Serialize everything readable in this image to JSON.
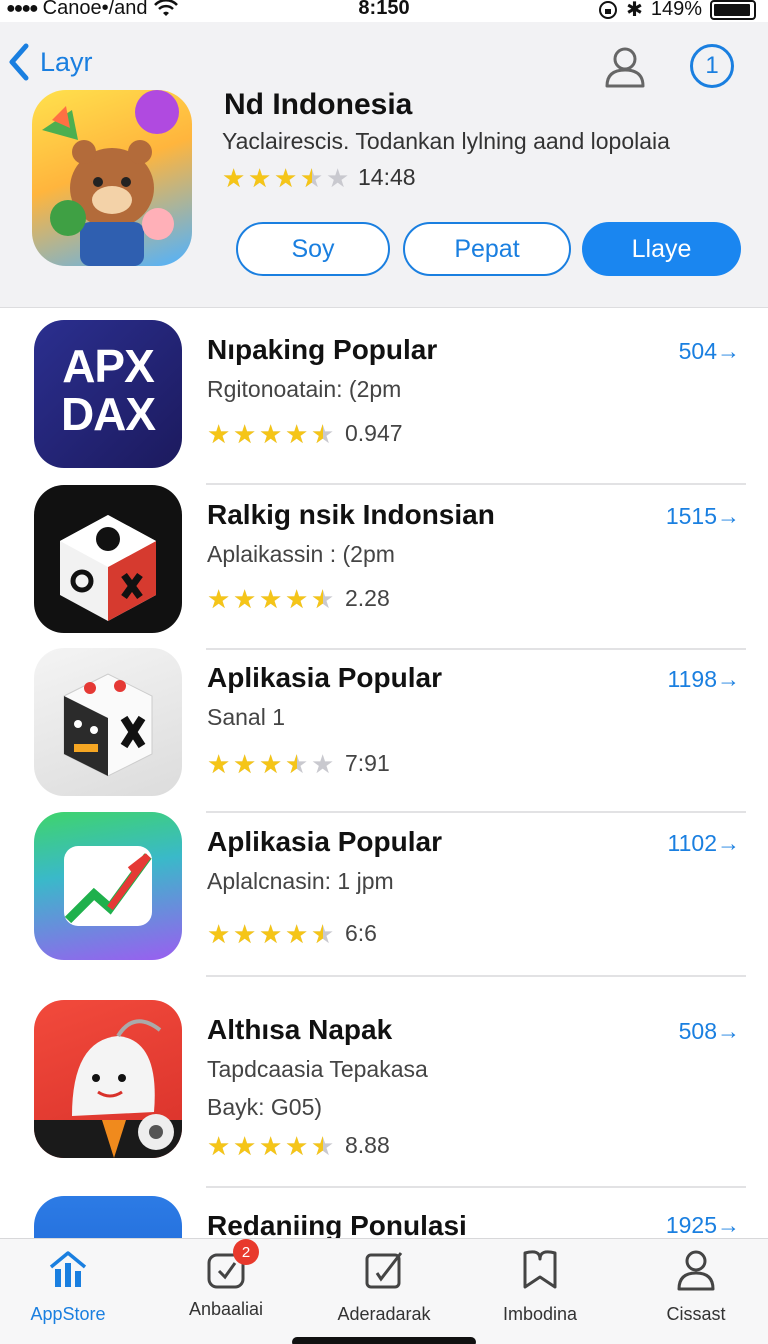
{
  "status": {
    "carrier": "Canoe•/and",
    "time": "8:150",
    "battery": "149%"
  },
  "header": {
    "back_label": "Layr",
    "badge_value": "1",
    "featured": {
      "title": "Nd Indonesia",
      "subtitle": "Yaclairescis. Todankan lylning aand lopolaia",
      "rating_text": "14:48",
      "stars": 3.5
    },
    "buttons": [
      "Soy",
      "Pepat",
      "Llaye"
    ]
  },
  "apps": [
    {
      "title": "Nıpaking Popular",
      "sub": "Rgitonoatain: (2pm",
      "sub2": "",
      "rating_text": "0.947",
      "count": "504→",
      "stars": 4.5
    },
    {
      "title": "Ralkig nsik Indonsian",
      "sub": "Aplaikassin : (2pm",
      "sub2": "",
      "rating_text": "2.28",
      "count": "1515→",
      "stars": 4.5
    },
    {
      "title": "Aplikasia Popular",
      "sub": "Sanal 1",
      "sub2": "",
      "rating_text": "7:91",
      "count": "1198→",
      "stars": 3.5
    },
    {
      "title": "Aplikasia Popular",
      "sub": "Aplalcnasin: 1 jpm",
      "sub2": "",
      "rating_text": "6:6",
      "count": "1102→",
      "stars": 4.5
    },
    {
      "title": "Althısa Napak",
      "sub": "Tapdcaasia Tepakasa",
      "sub2": "Bayk: G05)",
      "rating_text": "8.88",
      "count": "508→",
      "stars": 4.5
    },
    {
      "title": "Redaniing Ponulasi",
      "sub": "",
      "sub2": "",
      "rating_text": "",
      "count": "1925→",
      "stars": 0
    }
  ],
  "app_icon_text": {
    "apx": "APX",
    "dax": "DAX"
  },
  "tabs": [
    {
      "label": "AppStore",
      "icon": "chart-icon",
      "active": true
    },
    {
      "label": "Anbaaliai",
      "icon": "updates-icon",
      "badge": "2"
    },
    {
      "label": "Aderadarak",
      "icon": "edit-icon"
    },
    {
      "label": "Imbodina",
      "icon": "bookmark-icon"
    },
    {
      "label": "Cissast",
      "icon": "person-icon"
    }
  ],
  "colors": {
    "accent": "#1a7fe0",
    "star": "#f5c518",
    "badge": "#e8392c"
  }
}
